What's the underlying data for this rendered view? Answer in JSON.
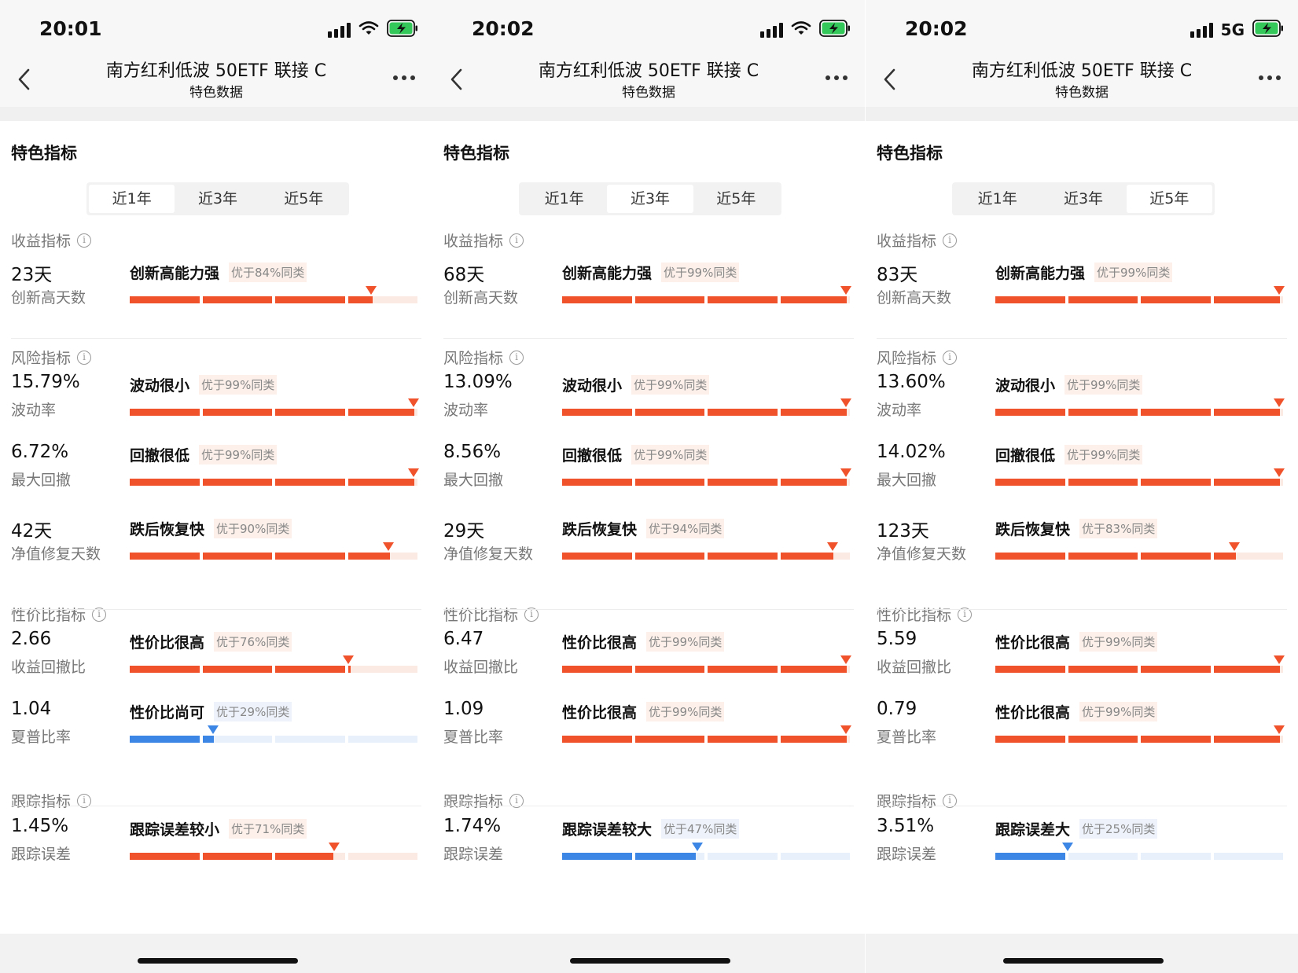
{
  "colors": {
    "orange": "#f0532c",
    "orange_track": "#fbe9e3",
    "blue": "#3c86e6",
    "blue_track": "#e8f0fb"
  },
  "panels": [
    {
      "time": "20:01",
      "network": "",
      "title": "南方红利低波 50ETF 联接 C",
      "subtitle": "特色数据",
      "section_title": "特色指标",
      "tabs": [
        "近1年",
        "近3年",
        "近5年"
      ],
      "active_tab": 0,
      "groups": [
        {
          "title": "收益指标",
          "metrics": [
            {
              "value": "23天",
              "name": "创新高天数",
              "rank": "创新高能力强",
              "badge": "优于84%同类",
              "percentile": 84,
              "color": "orange"
            }
          ]
        },
        {
          "title": "风险指标",
          "metrics": [
            {
              "value": "15.79%",
              "name": "波动率",
              "rank": "波动很小",
              "badge": "优于99%同类",
              "percentile": 99,
              "color": "orange"
            },
            {
              "value": "6.72%",
              "name": "最大回撤",
              "rank": "回撤很低",
              "badge": "优于99%同类",
              "percentile": 99,
              "color": "orange"
            },
            {
              "value": "42天",
              "name": "净值修复天数",
              "rank": "跌后恢复快",
              "badge": "优于90%同类",
              "percentile": 90,
              "color": "orange"
            }
          ]
        },
        {
          "title": "性价比指标",
          "metrics": [
            {
              "value": "2.66",
              "name": "收益回撤比",
              "rank": "性价比很高",
              "badge": "优于76%同类",
              "percentile": 76,
              "color": "orange"
            },
            {
              "value": "1.04",
              "name": "夏普比率",
              "rank": "性价比尚可",
              "badge": "优于29%同类",
              "percentile": 29,
              "color": "blue"
            }
          ]
        },
        {
          "title": "跟踪指标",
          "metrics": [
            {
              "value": "1.45%",
              "name": "跟踪误差",
              "rank": "跟踪误差较小",
              "badge": "优于71%同类",
              "percentile": 71,
              "color": "orange"
            }
          ]
        }
      ]
    },
    {
      "time": "20:02",
      "network": "",
      "title": "南方红利低波 50ETF 联接 C",
      "subtitle": "特色数据",
      "section_title": "特色指标",
      "tabs": [
        "近1年",
        "近3年",
        "近5年"
      ],
      "active_tab": 1,
      "groups": [
        {
          "title": "收益指标",
          "metrics": [
            {
              "value": "68天",
              "name": "创新高天数",
              "rank": "创新高能力强",
              "badge": "优于99%同类",
              "percentile": 99,
              "color": "orange"
            }
          ]
        },
        {
          "title": "风险指标",
          "metrics": [
            {
              "value": "13.09%",
              "name": "波动率",
              "rank": "波动很小",
              "badge": "优于99%同类",
              "percentile": 99,
              "color": "orange"
            },
            {
              "value": "8.56%",
              "name": "最大回撤",
              "rank": "回撤很低",
              "badge": "优于99%同类",
              "percentile": 99,
              "color": "orange"
            },
            {
              "value": "29天",
              "name": "净值修复天数",
              "rank": "跌后恢复快",
              "badge": "优于94%同类",
              "percentile": 94,
              "color": "orange"
            }
          ]
        },
        {
          "title": "性价比指标",
          "metrics": [
            {
              "value": "6.47",
              "name": "收益回撤比",
              "rank": "性价比很高",
              "badge": "优于99%同类",
              "percentile": 99,
              "color": "orange"
            },
            {
              "value": "1.09",
              "name": "夏普比率",
              "rank": "性价比很高",
              "badge": "优于99%同类",
              "percentile": 99,
              "color": "orange"
            }
          ]
        },
        {
          "title": "跟踪指标",
          "metrics": [
            {
              "value": "1.74%",
              "name": "跟踪误差",
              "rank": "跟踪误差较大",
              "badge": "优于47%同类",
              "percentile": 47,
              "color": "blue"
            }
          ]
        }
      ]
    },
    {
      "time": "20:02",
      "network": "5G",
      "title": "南方红利低波 50ETF 联接 C",
      "subtitle": "特色数据",
      "section_title": "特色指标",
      "tabs": [
        "近1年",
        "近3年",
        "近5年"
      ],
      "active_tab": 2,
      "groups": [
        {
          "title": "收益指标",
          "metrics": [
            {
              "value": "83天",
              "name": "创新高天数",
              "rank": "创新高能力强",
              "badge": "优于99%同类",
              "percentile": 99,
              "color": "orange"
            }
          ]
        },
        {
          "title": "风险指标",
          "metrics": [
            {
              "value": "13.60%",
              "name": "波动率",
              "rank": "波动很小",
              "badge": "优于99%同类",
              "percentile": 99,
              "color": "orange"
            },
            {
              "value": "14.02%",
              "name": "最大回撤",
              "rank": "回撤很低",
              "badge": "优于99%同类",
              "percentile": 99,
              "color": "orange"
            },
            {
              "value": "123天",
              "name": "净值修复天数",
              "rank": "跌后恢复快",
              "badge": "优于83%同类",
              "percentile": 83,
              "color": "orange"
            }
          ]
        },
        {
          "title": "性价比指标",
          "metrics": [
            {
              "value": "5.59",
              "name": "收益回撤比",
              "rank": "性价比很高",
              "badge": "优于99%同类",
              "percentile": 99,
              "color": "orange"
            },
            {
              "value": "0.79",
              "name": "夏普比率",
              "rank": "性价比很高",
              "badge": "优于99%同类",
              "percentile": 99,
              "color": "orange"
            }
          ]
        },
        {
          "title": "跟踪指标",
          "metrics": [
            {
              "value": "3.51%",
              "name": "跟踪误差",
              "rank": "跟踪误差大",
              "badge": "优于25%同类",
              "percentile": 25,
              "color": "blue"
            }
          ]
        }
      ]
    }
  ]
}
